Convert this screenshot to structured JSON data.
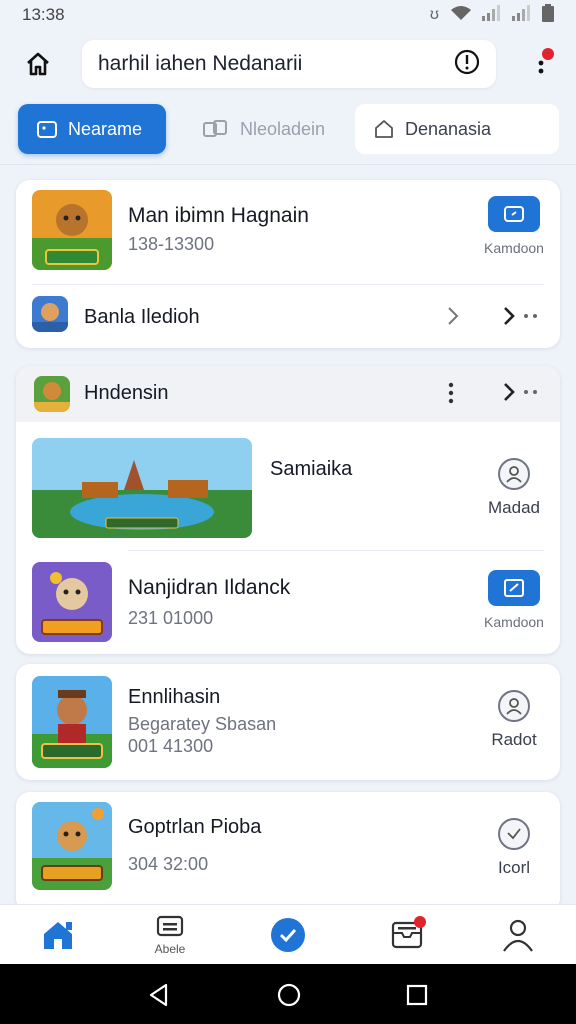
{
  "status": {
    "time": "13:38"
  },
  "search": {
    "value": "harhil iahen Nedanarii"
  },
  "tabs": [
    {
      "label": "Nearame"
    },
    {
      "label": "Nleoladein"
    },
    {
      "label": "Denanasia"
    }
  ],
  "card1": {
    "title": "Man ibimn Hagnain",
    "subtitle": "138-13300",
    "action_label": "Kamdoon",
    "row_label": "Banla Iledioh"
  },
  "section": {
    "header": "Hndensin",
    "featured_title": "Samiaika",
    "featured_action": "Madad",
    "item_title": "Nanjidran Ildanck",
    "item_subtitle": "231 01000",
    "item_action": "Kamdoon"
  },
  "card3": {
    "title": "Ennlihasin",
    "subtitle": "Begaratey Sbasan",
    "subtitle2": "001 41300",
    "action_label": "Radot"
  },
  "card4": {
    "title": "Goptrlan Pioba",
    "subtitle": "304 32:00",
    "action_label": "Icorl"
  },
  "nav": {
    "item2_label": "Abele"
  },
  "colors": {
    "accent": "#1f74d6",
    "badge": "#e0242c"
  }
}
